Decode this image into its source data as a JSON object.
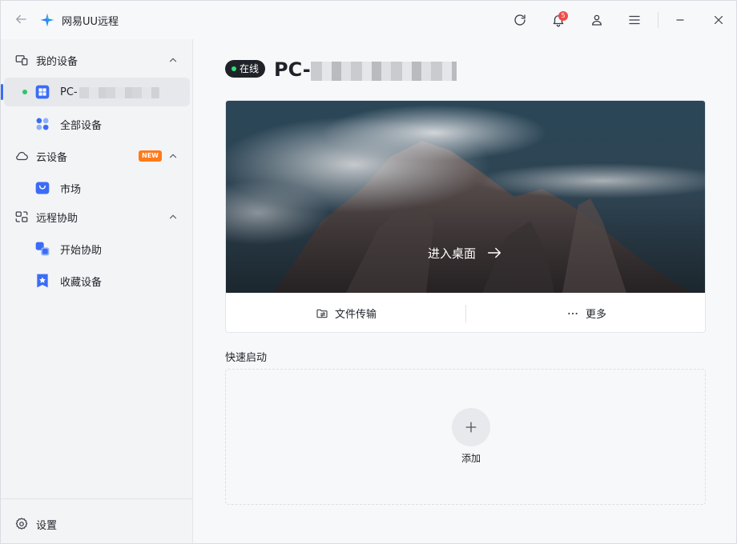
{
  "app": {
    "title": "网易UU远程",
    "notification_count": "5"
  },
  "sidebar": {
    "groups": [
      {
        "label": "我的设备",
        "items": [
          {
            "label": "PC-"
          },
          {
            "label": "全部设备"
          }
        ]
      },
      {
        "label": "云设备",
        "badge": "NEW",
        "items": [
          {
            "label": "市场"
          }
        ]
      },
      {
        "label": "远程协助",
        "items": [
          {
            "label": "开始协助"
          },
          {
            "label": "收藏设备"
          }
        ]
      }
    ],
    "settings_label": "设置"
  },
  "main": {
    "status": "在线",
    "device_name": "PC-",
    "enter_desktop": "进入桌面",
    "file_transfer": "文件传输",
    "more": "更多",
    "quick_start_title": "快速启动",
    "add_label": "添加"
  },
  "colors": {
    "accent": "#3b6cf6",
    "online": "#2fc36b",
    "new_badge": "#ff7a1a",
    "notification": "#f04b4b"
  }
}
